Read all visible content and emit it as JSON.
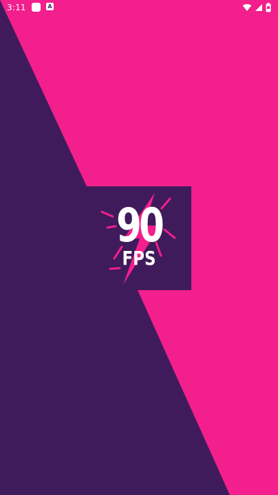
{
  "status_bar": {
    "time": "3:11",
    "notification_icons": [
      "app-icon",
      "a-icon"
    ],
    "a_icon_text": "A",
    "system_icons": [
      "wifi-icon",
      "signal-icon",
      "battery-icon"
    ]
  },
  "splash": {
    "logo_number": "90",
    "logo_label": "FPS"
  },
  "colors": {
    "pink": "#F21F8C",
    "purple": "#401B5C",
    "white": "#FFFFFF"
  }
}
